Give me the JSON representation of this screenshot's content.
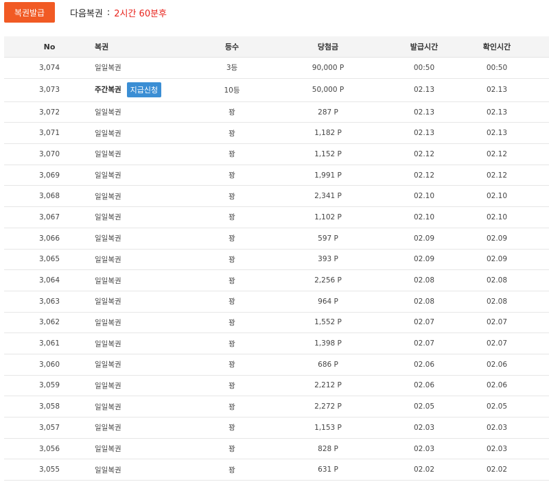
{
  "toolbar": {
    "issue_button": "복권발급",
    "next_label": "다음복권",
    "separator": ":",
    "next_time": "2시간 60분후"
  },
  "table": {
    "headers": {
      "no": "No",
      "name": "복권",
      "rank": "등수",
      "prize": "당첨금",
      "issued": "발급시간",
      "checked": "확인시간"
    },
    "rows": [
      {
        "no": "3,074",
        "name": "일일복권",
        "rank": "3등",
        "prize": "90,000 P",
        "issued": "00:50",
        "checked": "00:50"
      },
      {
        "no": "3,073",
        "name": "주간복권",
        "claim": "지급신청",
        "rank": "10등",
        "prize": "50,000 P",
        "issued": "02.13",
        "checked": "02.13"
      },
      {
        "no": "3,072",
        "name": "일일복권",
        "rank": "꽝",
        "prize": "287 P",
        "issued": "02.13",
        "checked": "02.13"
      },
      {
        "no": "3,071",
        "name": "일일복권",
        "rank": "꽝",
        "prize": "1,182 P",
        "issued": "02.13",
        "checked": "02.13"
      },
      {
        "no": "3,070",
        "name": "일일복권",
        "rank": "꽝",
        "prize": "1,152 P",
        "issued": "02.12",
        "checked": "02.12"
      },
      {
        "no": "3,069",
        "name": "일일복권",
        "rank": "꽝",
        "prize": "1,991 P",
        "issued": "02.12",
        "checked": "02.12"
      },
      {
        "no": "3,068",
        "name": "일일복권",
        "rank": "꽝",
        "prize": "2,341 P",
        "issued": "02.10",
        "checked": "02.10"
      },
      {
        "no": "3,067",
        "name": "일일복권",
        "rank": "꽝",
        "prize": "1,102 P",
        "issued": "02.10",
        "checked": "02.10"
      },
      {
        "no": "3,066",
        "name": "일일복권",
        "rank": "꽝",
        "prize": "597 P",
        "issued": "02.09",
        "checked": "02.09"
      },
      {
        "no": "3,065",
        "name": "일일복권",
        "rank": "꽝",
        "prize": "393 P",
        "issued": "02.09",
        "checked": "02.09"
      },
      {
        "no": "3,064",
        "name": "일일복권",
        "rank": "꽝",
        "prize": "2,256 P",
        "issued": "02.08",
        "checked": "02.08"
      },
      {
        "no": "3,063",
        "name": "일일복권",
        "rank": "꽝",
        "prize": "964 P",
        "issued": "02.08",
        "checked": "02.08"
      },
      {
        "no": "3,062",
        "name": "일일복권",
        "rank": "꽝",
        "prize": "1,552 P",
        "issued": "02.07",
        "checked": "02.07"
      },
      {
        "no": "3,061",
        "name": "일일복권",
        "rank": "꽝",
        "prize": "1,398 P",
        "issued": "02.07",
        "checked": "02.07"
      },
      {
        "no": "3,060",
        "name": "일일복권",
        "rank": "꽝",
        "prize": "686 P",
        "issued": "02.06",
        "checked": "02.06"
      },
      {
        "no": "3,059",
        "name": "일일복권",
        "rank": "꽝",
        "prize": "2,212 P",
        "issued": "02.06",
        "checked": "02.06"
      },
      {
        "no": "3,058",
        "name": "일일복권",
        "rank": "꽝",
        "prize": "2,272 P",
        "issued": "02.05",
        "checked": "02.05"
      },
      {
        "no": "3,057",
        "name": "일일복권",
        "rank": "꽝",
        "prize": "1,153 P",
        "issued": "02.03",
        "checked": "02.03"
      },
      {
        "no": "3,056",
        "name": "일일복권",
        "rank": "꽝",
        "prize": "828 P",
        "issued": "02.03",
        "checked": "02.03"
      },
      {
        "no": "3,055",
        "name": "일일복권",
        "rank": "꽝",
        "prize": "631 P",
        "issued": "02.02",
        "checked": "02.02"
      }
    ]
  },
  "colors": {
    "accent": "#f15a24",
    "next_time": "#e8231c",
    "claim_button": "#3b8ed4",
    "header_bg": "#f4f4f4"
  }
}
